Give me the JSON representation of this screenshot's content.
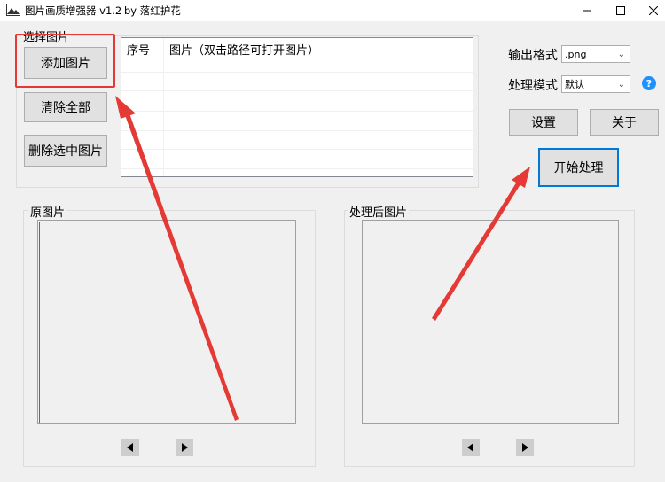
{
  "window": {
    "title": "图片画质增强器 v1.2",
    "author": "by 落红护花"
  },
  "input_group": {
    "label": "选择图片",
    "buttons": {
      "add": "添加图片",
      "clear": "清除全部",
      "delete": "删除选中图片"
    },
    "list": {
      "columns": [
        "序号",
        "图片（双击路径可打开图片）"
      ]
    }
  },
  "settings": {
    "output_format_label": "输出格式",
    "output_format_value": ".png",
    "mode_label": "处理模式",
    "mode_value": "默认",
    "settings_button": "设置",
    "about_button": "关于",
    "start_button": "开始处理",
    "help_icon_text": "?"
  },
  "panels": {
    "original_label": "原图片",
    "processed_label": "处理后图片"
  },
  "annotations": {
    "highlight_color": "#e53935",
    "arrow_color": "#e53935"
  }
}
